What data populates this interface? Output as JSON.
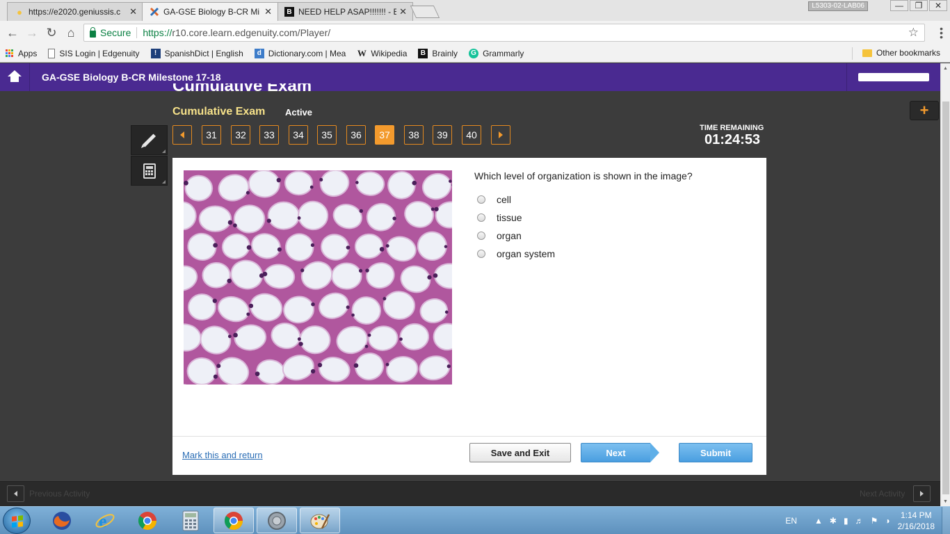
{
  "browser": {
    "tabs": [
      {
        "title": "https://e2020.geniussis.c",
        "icon": "lightbulb-icon"
      },
      {
        "title": "GA-GSE Biology B-CR Mi",
        "icon": "edgenuity-x-icon"
      },
      {
        "title": "NEED HELP ASAP!!!!!!! - B",
        "icon": "brainly-icon"
      }
    ],
    "window_user": "L5303-02-LAB06",
    "secure_label": "Secure",
    "url_prefix": "https://",
    "url_rest": "r10.core.learn.edgenuity.com/Player/",
    "bookmarks": [
      "Apps",
      "SIS Login | Edgenuity",
      "SpanishDict | English",
      "Dictionary.com | Mea",
      "Wikipedia",
      "Brainly",
      "Grammarly"
    ],
    "other_bookmarks": "Other bookmarks"
  },
  "course": {
    "title": "GA-GSE Biology B-CR Milestone 17-18"
  },
  "exam": {
    "cut_title": "Cumulative Exam",
    "subtitle": "Cumulative Exam",
    "status": "Active",
    "question_numbers": [
      "31",
      "32",
      "33",
      "34",
      "35",
      "36",
      "37",
      "38",
      "39",
      "40"
    ],
    "current_question": "37",
    "timer_label": "TIME REMAINING",
    "timer_value": "01:24:53",
    "expand_symbol": "+"
  },
  "question": {
    "text": "Which level of organization is shown in the image?",
    "image_subject": "adipose-tissue-micrograph",
    "options": [
      "cell",
      "tissue",
      "organ",
      "organ system"
    ]
  },
  "footer": {
    "mark_label": "Mark this and return",
    "save_label": "Save and Exit",
    "next_label": "Next",
    "submit_label": "Submit"
  },
  "activity": {
    "prev_label": "Previous Activity",
    "next_label": "Next Activity"
  },
  "taskbar": {
    "apps": [
      "firefox-icon",
      "internet-explorer-icon",
      "chrome-icon",
      "calculator-icon",
      "chrome-icon",
      "speaker-icon",
      "paint-icon"
    ],
    "language": "EN",
    "time": "1:14 PM",
    "date": "2/16/2018"
  },
  "colors": {
    "header_purple": "#4a2a91",
    "accent_orange": "#f39a2d",
    "button_blue": "#4a9ee0",
    "link_blue": "#2a6db5",
    "secure_green": "#0b8043"
  }
}
